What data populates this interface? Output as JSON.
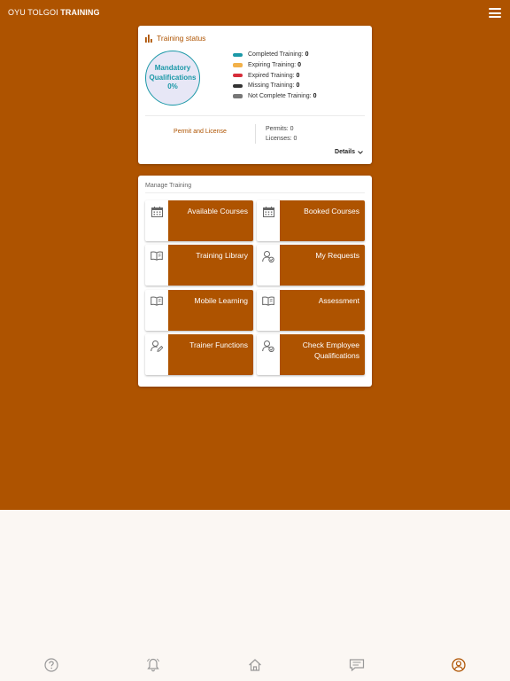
{
  "header": {
    "brand_light": "OYU TOLGOI ",
    "brand_bold": "TRAINING"
  },
  "status": {
    "title": "Training status",
    "ring": {
      "line1": "Mandatory",
      "line2": "Qualifications",
      "percent": "0%"
    },
    "legend": [
      {
        "label": "Completed Training:",
        "value": "0",
        "color": "#1b98a7"
      },
      {
        "label": "Expiring Training:",
        "value": "0",
        "color": "#f2b14a"
      },
      {
        "label": "Expired Training:",
        "value": "0",
        "color": "#d62d3a"
      },
      {
        "label": "Missing Training:",
        "value": "0",
        "color": "#333333"
      },
      {
        "label": "Not Complete Training:",
        "value": "0",
        "color": "#777777"
      }
    ],
    "permit_link": "Permit and License",
    "permits": "Permits: 0",
    "licenses": "Licenses: 0",
    "details": "Details"
  },
  "manage": {
    "title": "Manage Training",
    "tiles": [
      {
        "label": "Available Courses",
        "icon": "calendar-icon"
      },
      {
        "label": "Booked Courses",
        "icon": "calendar-icon"
      },
      {
        "label": "Training Library",
        "icon": "book-icon"
      },
      {
        "label": "My Requests",
        "icon": "user-check-icon"
      },
      {
        "label": "Mobile Learning",
        "icon": "book-icon"
      },
      {
        "label": "Assessment",
        "icon": "book-icon"
      },
      {
        "label": "Trainer Functions",
        "icon": "user-edit-icon"
      },
      {
        "label": "Check Employee Qualifications",
        "icon": "user-check-icon"
      }
    ]
  },
  "nav": [
    "help-icon",
    "bell-icon",
    "home-icon",
    "chat-icon",
    "profile-icon"
  ],
  "colors": {
    "brand": "#ae5300",
    "accent": "#1b98a7",
    "background": "#fbf7f3"
  }
}
